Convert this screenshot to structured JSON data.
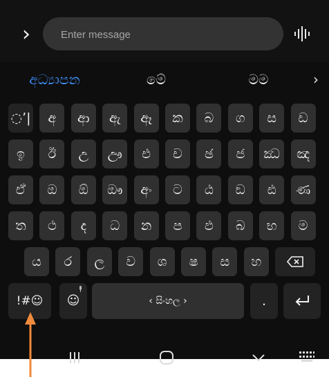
{
  "message_bar": {
    "expand_icon": "chevron-right-icon",
    "placeholder": "Enter message",
    "voice_icon": "voice-input-icon"
  },
  "suggestions": {
    "items": [
      "අධ්‍යාපන",
      "මේ",
      "මම"
    ],
    "more_icon": "chevron-right-icon"
  },
  "keyboard": {
    "rows": [
      [
        "◌ʼ|",
        "අ",
        "ආ",
        "ඇ",
        "ඈ",
        "ක",
        "බ",
        "ග",
        "ස",
        "ඩ"
      ],
      [
        "ඉ",
        "ඊ",
        "උ",
        "ඌ",
        "එ",
        "ච",
        "ඡ",
        "ජ",
        "ඣ",
        "ඤ"
      ],
      [
        "ඒ",
        "ඔ",
        "ඕ",
        "ඖ",
        "අං",
        "ට",
        "ඨ",
        "ඞ",
        "ඪ",
        "ණ"
      ],
      [
        "ත",
        "ථ",
        "ද",
        "ධ",
        "න",
        "ප",
        "ඵ",
        "බ",
        "භ",
        "ම"
      ],
      [
        "ය",
        "ර",
        "ල",
        "ව",
        "ශ",
        "ෂ",
        "ස",
        "හ"
      ]
    ],
    "backspace_icon": "backspace-icon",
    "symbols_label": "!#☺",
    "emoji_label": "☺",
    "space_label": "‹ සිංහල ›",
    "period_label": ".",
    "enter_icon": "enter-icon"
  },
  "nav": {
    "recent_icon": "recent-apps-icon",
    "home_icon": "home-icon",
    "hide_keyboard_icon": "chevron-down-icon",
    "keyboard_switch_icon": "keyboard-switch-icon"
  },
  "annotation": {
    "arrow_color": "#f08a3c",
    "target": "symbols-key"
  },
  "colors": {
    "background": "#0e0e0e",
    "key": "#303030",
    "function_key": "#232323",
    "accent": "#3e8ef7"
  }
}
